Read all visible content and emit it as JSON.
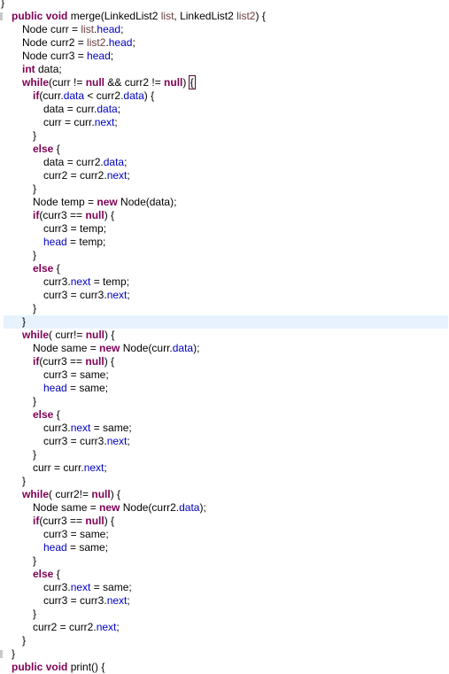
{
  "editor": {
    "language": "java",
    "current_line_index": 24,
    "matched_bracket": {
      "line": 6,
      "text": "{"
    },
    "colors": {
      "keyword": "#7f0055",
      "field": "#0000c0",
      "parameter": "#6a3e3e",
      "default": "#000000",
      "current_line_bg": "#e8f2fe",
      "bracket_outline": "#4b0d33"
    },
    "lines": [
      {
        "indent": 0,
        "tokens": [
          {
            "t": "}",
            "k": ""
          }
        ]
      },
      {
        "indent": 1,
        "tokens": [
          {
            "t": "public",
            "k": "kw"
          },
          {
            "t": " ",
            "k": ""
          },
          {
            "t": "void",
            "k": "kw"
          },
          {
            "t": " merge(LinkedList2 ",
            "k": ""
          },
          {
            "t": "list",
            "k": "param"
          },
          {
            "t": ", LinkedList2 ",
            "k": ""
          },
          {
            "t": "list2",
            "k": "param"
          },
          {
            "t": ") {",
            "k": ""
          }
        ]
      },
      {
        "indent": 2,
        "tokens": [
          {
            "t": "Node curr = ",
            "k": ""
          },
          {
            "t": "list",
            "k": "param"
          },
          {
            "t": ".",
            "k": ""
          },
          {
            "t": "head",
            "k": "fld"
          },
          {
            "t": ";",
            "k": ""
          }
        ]
      },
      {
        "indent": 2,
        "tokens": [
          {
            "t": "Node curr2 = ",
            "k": ""
          },
          {
            "t": "list2",
            "k": "param"
          },
          {
            "t": ".",
            "k": ""
          },
          {
            "t": "head",
            "k": "fld"
          },
          {
            "t": ";",
            "k": ""
          }
        ]
      },
      {
        "indent": 2,
        "tokens": [
          {
            "t": "Node curr3 = ",
            "k": ""
          },
          {
            "t": "head",
            "k": "fld"
          },
          {
            "t": ";",
            "k": ""
          }
        ]
      },
      {
        "indent": 2,
        "tokens": [
          {
            "t": "int",
            "k": "kw"
          },
          {
            "t": " data;",
            "k": ""
          }
        ]
      },
      {
        "indent": 2,
        "tokens": [
          {
            "t": "while",
            "k": "kw"
          },
          {
            "t": "(curr != ",
            "k": ""
          },
          {
            "t": "null",
            "k": "kw"
          },
          {
            "t": " && curr2 != ",
            "k": ""
          },
          {
            "t": "null",
            "k": "kw"
          },
          {
            "t": ") ",
            "k": ""
          },
          {
            "t": "{",
            "k": "match"
          }
        ]
      },
      {
        "indent": 3,
        "tokens": [
          {
            "t": "if",
            "k": "kw"
          },
          {
            "t": "(curr.",
            "k": ""
          },
          {
            "t": "data",
            "k": "fld"
          },
          {
            "t": " < curr2.",
            "k": ""
          },
          {
            "t": "data",
            "k": "fld"
          },
          {
            "t": ") {",
            "k": ""
          }
        ]
      },
      {
        "indent": 4,
        "tokens": [
          {
            "t": "data = curr.",
            "k": ""
          },
          {
            "t": "data",
            "k": "fld"
          },
          {
            "t": ";",
            "k": ""
          }
        ]
      },
      {
        "indent": 4,
        "tokens": [
          {
            "t": "curr = curr.",
            "k": ""
          },
          {
            "t": "next",
            "k": "fld"
          },
          {
            "t": ";",
            "k": ""
          }
        ]
      },
      {
        "indent": 3,
        "tokens": [
          {
            "t": "}",
            "k": ""
          }
        ]
      },
      {
        "indent": 3,
        "tokens": [
          {
            "t": "else",
            "k": "kw"
          },
          {
            "t": " {",
            "k": ""
          }
        ]
      },
      {
        "indent": 4,
        "tokens": [
          {
            "t": "data = curr2.",
            "k": ""
          },
          {
            "t": "data",
            "k": "fld"
          },
          {
            "t": ";",
            "k": ""
          }
        ]
      },
      {
        "indent": 4,
        "tokens": [
          {
            "t": "curr2 = curr2.",
            "k": ""
          },
          {
            "t": "next",
            "k": "fld"
          },
          {
            "t": ";",
            "k": ""
          }
        ]
      },
      {
        "indent": 3,
        "tokens": [
          {
            "t": "}",
            "k": ""
          }
        ]
      },
      {
        "indent": 3,
        "tokens": [
          {
            "t": "Node temp = ",
            "k": ""
          },
          {
            "t": "new",
            "k": "kw"
          },
          {
            "t": " Node(data);",
            "k": ""
          }
        ]
      },
      {
        "indent": 3,
        "tokens": [
          {
            "t": "if",
            "k": "kw"
          },
          {
            "t": "(curr3 == ",
            "k": ""
          },
          {
            "t": "null",
            "k": "kw"
          },
          {
            "t": ") {",
            "k": ""
          }
        ]
      },
      {
        "indent": 4,
        "tokens": [
          {
            "t": "curr3 = temp;",
            "k": ""
          }
        ]
      },
      {
        "indent": 4,
        "tokens": [
          {
            "t": "head",
            "k": "fld"
          },
          {
            "t": " = temp;",
            "k": ""
          }
        ]
      },
      {
        "indent": 3,
        "tokens": [
          {
            "t": "}",
            "k": ""
          }
        ]
      },
      {
        "indent": 3,
        "tokens": [
          {
            "t": "else",
            "k": "kw"
          },
          {
            "t": " {",
            "k": ""
          }
        ]
      },
      {
        "indent": 4,
        "tokens": [
          {
            "t": "curr3.",
            "k": ""
          },
          {
            "t": "next",
            "k": "fld"
          },
          {
            "t": " = temp;",
            "k": ""
          }
        ]
      },
      {
        "indent": 4,
        "tokens": [
          {
            "t": "curr3 = curr3.",
            "k": ""
          },
          {
            "t": "next",
            "k": "fld"
          },
          {
            "t": ";",
            "k": ""
          }
        ]
      },
      {
        "indent": 3,
        "tokens": [
          {
            "t": "}",
            "k": ""
          }
        ]
      },
      {
        "indent": 2,
        "tokens": [
          {
            "t": "}",
            "k": ""
          }
        ]
      },
      {
        "indent": 2,
        "tokens": [
          {
            "t": "while",
            "k": "kw"
          },
          {
            "t": "( curr!= ",
            "k": ""
          },
          {
            "t": "null",
            "k": "kw"
          },
          {
            "t": ") {",
            "k": ""
          }
        ]
      },
      {
        "indent": 3,
        "tokens": [
          {
            "t": "Node same = ",
            "k": ""
          },
          {
            "t": "new",
            "k": "kw"
          },
          {
            "t": " Node(curr.",
            "k": ""
          },
          {
            "t": "data",
            "k": "fld"
          },
          {
            "t": ");",
            "k": ""
          }
        ]
      },
      {
        "indent": 3,
        "tokens": [
          {
            "t": "if",
            "k": "kw"
          },
          {
            "t": "(curr3 == ",
            "k": ""
          },
          {
            "t": "null",
            "k": "kw"
          },
          {
            "t": ") {",
            "k": ""
          }
        ]
      },
      {
        "indent": 4,
        "tokens": [
          {
            "t": "curr3 = same;",
            "k": ""
          }
        ]
      },
      {
        "indent": 4,
        "tokens": [
          {
            "t": "head",
            "k": "fld"
          },
          {
            "t": " = same;",
            "k": ""
          }
        ]
      },
      {
        "indent": 3,
        "tokens": [
          {
            "t": "}",
            "k": ""
          }
        ]
      },
      {
        "indent": 3,
        "tokens": [
          {
            "t": "else",
            "k": "kw"
          },
          {
            "t": " {",
            "k": ""
          }
        ]
      },
      {
        "indent": 4,
        "tokens": [
          {
            "t": "curr3.",
            "k": ""
          },
          {
            "t": "next",
            "k": "fld"
          },
          {
            "t": " = same;",
            "k": ""
          }
        ]
      },
      {
        "indent": 4,
        "tokens": [
          {
            "t": "curr3 = curr3.",
            "k": ""
          },
          {
            "t": "next",
            "k": "fld"
          },
          {
            "t": ";",
            "k": ""
          }
        ]
      },
      {
        "indent": 3,
        "tokens": [
          {
            "t": "}",
            "k": ""
          }
        ]
      },
      {
        "indent": 3,
        "tokens": [
          {
            "t": "curr = curr.",
            "k": ""
          },
          {
            "t": "next",
            "k": "fld"
          },
          {
            "t": ";",
            "k": ""
          }
        ]
      },
      {
        "indent": 2,
        "tokens": [
          {
            "t": "}",
            "k": ""
          }
        ]
      },
      {
        "indent": 2,
        "tokens": [
          {
            "t": "while",
            "k": "kw"
          },
          {
            "t": "( curr2!= ",
            "k": ""
          },
          {
            "t": "null",
            "k": "kw"
          },
          {
            "t": ") {",
            "k": ""
          }
        ]
      },
      {
        "indent": 3,
        "tokens": [
          {
            "t": "Node same = ",
            "k": ""
          },
          {
            "t": "new",
            "k": "kw"
          },
          {
            "t": " Node(curr2.",
            "k": ""
          },
          {
            "t": "data",
            "k": "fld"
          },
          {
            "t": ");",
            "k": ""
          }
        ]
      },
      {
        "indent": 3,
        "tokens": [
          {
            "t": "if",
            "k": "kw"
          },
          {
            "t": "(curr3 == ",
            "k": ""
          },
          {
            "t": "null",
            "k": "kw"
          },
          {
            "t": ") {",
            "k": ""
          }
        ]
      },
      {
        "indent": 4,
        "tokens": [
          {
            "t": "curr3 = same;",
            "k": ""
          }
        ]
      },
      {
        "indent": 4,
        "tokens": [
          {
            "t": "head",
            "k": "fld"
          },
          {
            "t": " = same;",
            "k": ""
          }
        ]
      },
      {
        "indent": 3,
        "tokens": [
          {
            "t": "}",
            "k": ""
          }
        ]
      },
      {
        "indent": 3,
        "tokens": [
          {
            "t": "else",
            "k": "kw"
          },
          {
            "t": " {",
            "k": ""
          }
        ]
      },
      {
        "indent": 4,
        "tokens": [
          {
            "t": "curr3.",
            "k": ""
          },
          {
            "t": "next",
            "k": "fld"
          },
          {
            "t": " = same;",
            "k": ""
          }
        ]
      },
      {
        "indent": 4,
        "tokens": [
          {
            "t": "curr3 = curr3.",
            "k": ""
          },
          {
            "t": "next",
            "k": "fld"
          },
          {
            "t": ";",
            "k": ""
          }
        ]
      },
      {
        "indent": 3,
        "tokens": [
          {
            "t": "}",
            "k": ""
          }
        ]
      },
      {
        "indent": 3,
        "tokens": [
          {
            "t": "curr2 = curr2.",
            "k": ""
          },
          {
            "t": "next",
            "k": "fld"
          },
          {
            "t": ";",
            "k": ""
          }
        ]
      },
      {
        "indent": 2,
        "tokens": [
          {
            "t": "}",
            "k": ""
          }
        ]
      },
      {
        "indent": 1,
        "tokens": [
          {
            "t": "}",
            "k": ""
          }
        ]
      },
      {
        "indent": 1,
        "tokens": [
          {
            "t": "public",
            "k": "kw"
          },
          {
            "t": " ",
            "k": ""
          },
          {
            "t": "void",
            "k": "kw"
          },
          {
            "t": " print() {",
            "k": ""
          }
        ]
      }
    ]
  }
}
